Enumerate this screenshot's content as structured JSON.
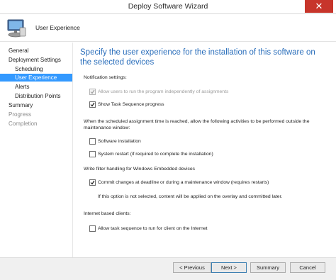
{
  "window": {
    "title": "Deploy Software Wizard",
    "close_glyph": "✕"
  },
  "header": {
    "label": "User Experience",
    "icon": "computer-icon"
  },
  "sidebar": {
    "items": [
      {
        "label": "General",
        "state": "normal"
      },
      {
        "label": "Deployment Settings",
        "state": "normal"
      },
      {
        "label": "Scheduling",
        "state": "normal"
      },
      {
        "label": "User Experience",
        "state": "selected"
      },
      {
        "label": "Alerts",
        "state": "normal"
      },
      {
        "label": "Distribution Points",
        "state": "normal"
      },
      {
        "label": "Summary",
        "state": "normal"
      },
      {
        "label": "Progress",
        "state": "disabled"
      },
      {
        "label": "Completion",
        "state": "disabled"
      }
    ],
    "selected_color": "#3399ff"
  },
  "main": {
    "heading": "Specify the user experience for the installation of this software on the selected devices",
    "heading_color": "#2a6ebb",
    "notification": {
      "label": "Notification settings:",
      "allow_independent": {
        "label": "Allow users to run the program independently of assignments",
        "checked": true,
        "enabled": false
      },
      "show_progress": {
        "label": "Show Task Sequence progress",
        "checked": true,
        "enabled": true
      }
    },
    "maintenance": {
      "label": "When the scheduled assignment time is reached, allow the following activities to be performed outside the maintenance window:",
      "software_install": {
        "label": "Software installation",
        "checked": false
      },
      "system_restart": {
        "label": "System restart (if required to complete the installation)",
        "checked": false
      }
    },
    "write_filter": {
      "label": "Write filter handling for Windows Embedded devices",
      "commit_changes": {
        "label": "Commit changes at deadline or during a maintenance window (requires restarts)",
        "checked": true
      },
      "note": "If this option is not selected, content will be applied on the overlay and committed later."
    },
    "internet": {
      "label": "Internet based clients:",
      "allow_internet": {
        "label": "Allow task sequence to run for client on the Internet",
        "checked": false
      }
    }
  },
  "footer": {
    "previous": "< Previous",
    "next": "Next >",
    "summary": "Summary",
    "cancel": "Cancel"
  }
}
